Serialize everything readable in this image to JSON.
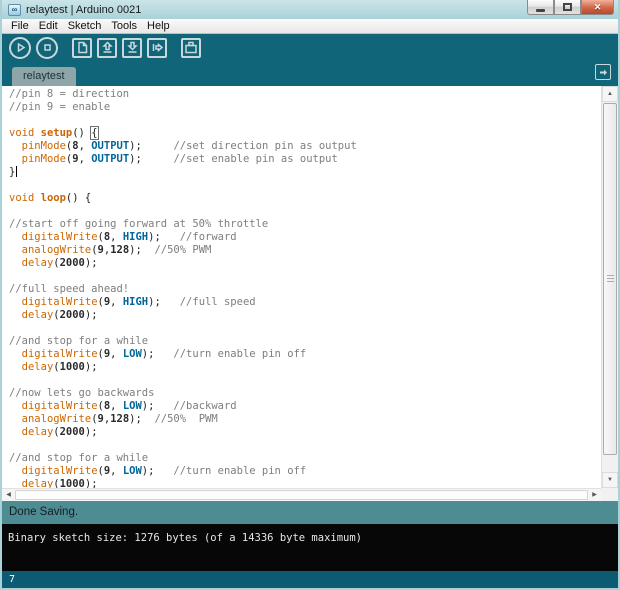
{
  "colors": {
    "app_background": "#116579",
    "statusbar": "#4E8C94",
    "tab_active": "#8FA6A9",
    "console_background": "#070707",
    "footer_background": "#0C5B73",
    "icon_stroke": "#C9D8DB",
    "close_button": "#CE6749"
  },
  "window": {
    "title": "relaytest | Arduino 0021"
  },
  "menu": {
    "items": [
      "File",
      "Edit",
      "Sketch",
      "Tools",
      "Help"
    ]
  },
  "toolbar": {
    "buttons": [
      "verify",
      "stop",
      "new",
      "open",
      "save",
      "upload",
      "serial-monitor"
    ]
  },
  "tabs": {
    "active": "relaytest"
  },
  "editor": {
    "lines": [
      "//pin 8 = direction",
      "//pin 9 = enable",
      "",
      "void setup() {",
      "  pinMode(8, OUTPUT);     //set direction pin as output",
      "  pinMode(9, OUTPUT);     //set enable pin as output",
      "}",
      "",
      "void loop() {",
      "",
      "//start off going forward at 50% throttle",
      "  digitalWrite(8, HIGH);   //forward",
      "  analogWrite(9,128);  //50% PWM",
      "  delay(2000);",
      "",
      "//full speed ahead!",
      "  digitalWrite(9, HIGH);   //full speed",
      "  delay(2000);",
      "",
      "//and stop for a while",
      "  digitalWrite(9, LOW);   //turn enable pin off",
      "  delay(1000);",
      "",
      "//now lets go backwards",
      "  digitalWrite(8, LOW);   //backward",
      "  analogWrite(9,128);  //50%  PWM",
      "  delay(2000);",
      "",
      "//and stop for a while",
      "  digitalWrite(9, LOW);   //turn enable pin off",
      "  delay(1000);"
    ],
    "brace_box_line": 3,
    "caret_after_line": 6,
    "syntax": {
      "keywords": [
        "void"
      ],
      "structure": [
        "setup",
        "loop"
      ],
      "functions": [
        "pinMode",
        "digitalWrite",
        "analogWrite",
        "delay"
      ],
      "constants": [
        "OUTPUT",
        "HIGH",
        "LOW"
      ],
      "colors": {
        "comment": "#7E7E7E",
        "keyword": "#CC6600",
        "structure": "#CC6600",
        "function": "#CC6600",
        "constant": "#006699",
        "number": "#2B2B2B",
        "plain": "#1F1F1F"
      }
    }
  },
  "status": {
    "message": "Done Saving."
  },
  "console": {
    "text": "Binary sketch size: 1276 bytes (of a 14336 byte maximum)"
  },
  "footer": {
    "line_number": "7"
  }
}
